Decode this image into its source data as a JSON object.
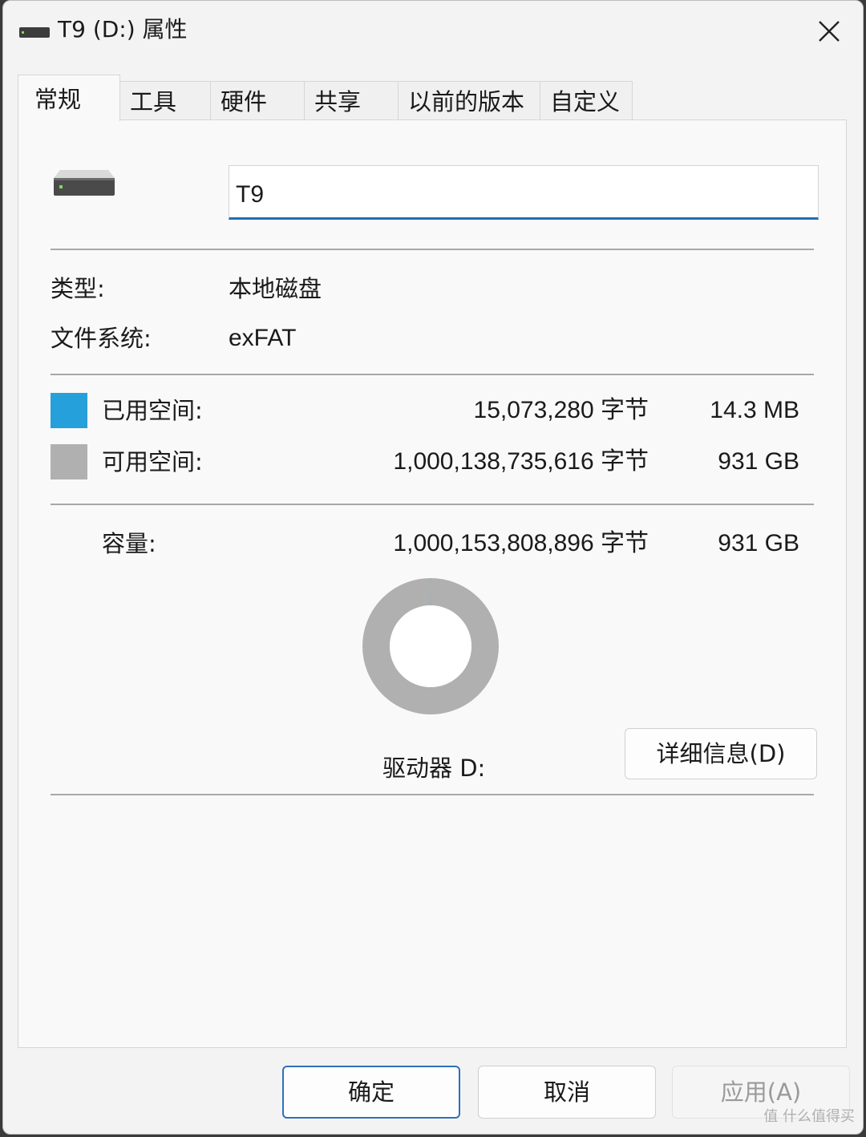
{
  "window": {
    "title": "T9 (D:) 属性",
    "close_icon": "close-icon"
  },
  "tabs": [
    {
      "label": "常规",
      "active": true
    },
    {
      "label": "工具",
      "active": false
    },
    {
      "label": "硬件",
      "active": false
    },
    {
      "label": "共享",
      "active": false
    },
    {
      "label": "以前的版本",
      "active": false
    },
    {
      "label": "自定义",
      "active": false
    }
  ],
  "general": {
    "drive_icon": "hard-drive-icon",
    "name_value": "T9",
    "type_label": "类型:",
    "type_value": "本地磁盘",
    "fs_label": "文件系统:",
    "fs_value": "exFAT",
    "used": {
      "label": "已用空间:",
      "bytes": "15,073,280 字节",
      "size": "14.3 MB",
      "color": "#26a0da"
    },
    "free": {
      "label": "可用空间:",
      "bytes": "1,000,138,735,616 字节",
      "size": "931 GB",
      "color": "#b0b0b0"
    },
    "capacity": {
      "label": "容量:",
      "bytes": "1,000,153,808,896 字节",
      "size": "931 GB"
    },
    "drive_label": "驱动器 D:",
    "details_button": "详细信息(D)"
  },
  "footer": {
    "ok": "确定",
    "cancel": "取消",
    "apply": "应用(A)"
  },
  "watermark": "值 什么值得买"
}
